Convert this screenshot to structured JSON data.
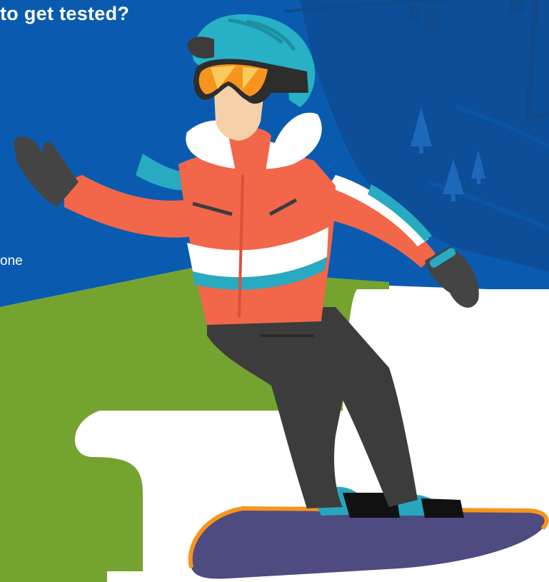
{
  "headline": "to get tested?",
  "body_fragment": "one",
  "illustration": {
    "subject": "snowboarder-icon",
    "colors": {
      "sky": "#0a5bb0",
      "mountain": "#0c4e97",
      "hill": "#75a32f",
      "snow": "#ffffff",
      "jacket": "#f26649",
      "jacket_stripe": "#28aac2",
      "helmet": "#27b0c6",
      "goggles": "#f7941d",
      "pants": "#3c3c3c",
      "gloves": "#444444",
      "skin": "#f5d0a9",
      "board": "#4e4b80",
      "board_edge": "#f7941d"
    }
  }
}
